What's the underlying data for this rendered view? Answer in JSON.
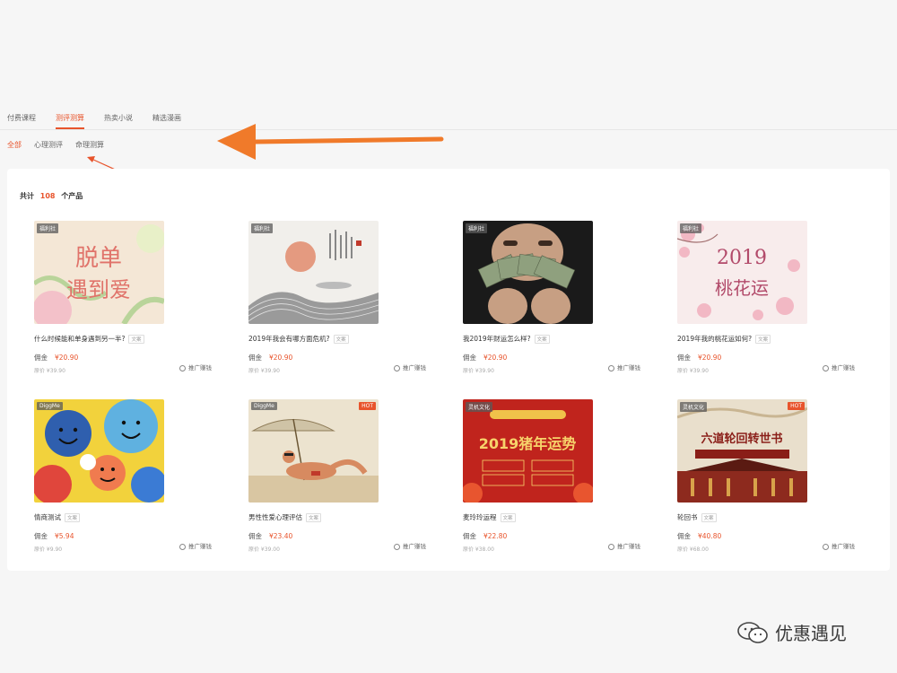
{
  "top_tabs": [
    "付费课程",
    "测评测算",
    "热卖小说",
    "精选漫画"
  ],
  "sub_tabs": [
    "全部",
    "心理测评",
    "命理测算"
  ],
  "count": {
    "prefix": "共计",
    "number": "108",
    "suffix": "个产品"
  },
  "promote_label": "推广赚钱",
  "commission_label": "佣金",
  "products": [
    {
      "title": "什么时候能和单身遇到另一半?",
      "tag": "文案",
      "price": "¥20.90",
      "orig": "原价 ¥39.90",
      "badge": "福利社",
      "badge_right": "",
      "thumb_text": "脱单\n遇到爱"
    },
    {
      "title": "2019年我会有哪方面危机?",
      "tag": "文案",
      "price": "¥20.90",
      "orig": "原价 ¥39.90",
      "badge": "福利社",
      "badge_right": "",
      "thumb_text": ""
    },
    {
      "title": "我2019年财运怎么样?",
      "tag": "文案",
      "price": "¥20.90",
      "orig": "原价 ¥39.90",
      "badge": "福利社",
      "badge_right": "",
      "thumb_text": ""
    },
    {
      "title": "2019年我的桃花运如何?",
      "tag": "文案",
      "price": "¥20.90",
      "orig": "原价 ¥39.90",
      "badge": "福利社",
      "badge_right": "",
      "thumb_text": "2019\n桃花运"
    },
    {
      "title": "情商测试",
      "tag": "文案",
      "price": "¥5.94",
      "orig": "原价 ¥9.90",
      "badge": "DiggMe",
      "badge_right": "",
      "thumb_text": ""
    },
    {
      "title": "男性性爱心理评估",
      "tag": "文案",
      "price": "¥23.40",
      "orig": "原价 ¥39.00",
      "badge": "DiggMe",
      "badge_right": "HOT",
      "thumb_text": ""
    },
    {
      "title": "麦玲玲运程",
      "tag": "文案",
      "price": "¥22.80",
      "orig": "原价 ¥38.00",
      "badge": "灵机文化",
      "badge_right": "",
      "thumb_text": "2019猪年运势"
    },
    {
      "title": "轮回书",
      "tag": "文案",
      "price": "¥40.80",
      "orig": "原价 ¥68.00",
      "badge": "灵机文化",
      "badge_right": "HOT",
      "thumb_text": "六道轮回转世书"
    }
  ],
  "watermark": "优惠遇见",
  "colors": {
    "accent": "#e8542c",
    "arrow": "#f07a2a"
  }
}
